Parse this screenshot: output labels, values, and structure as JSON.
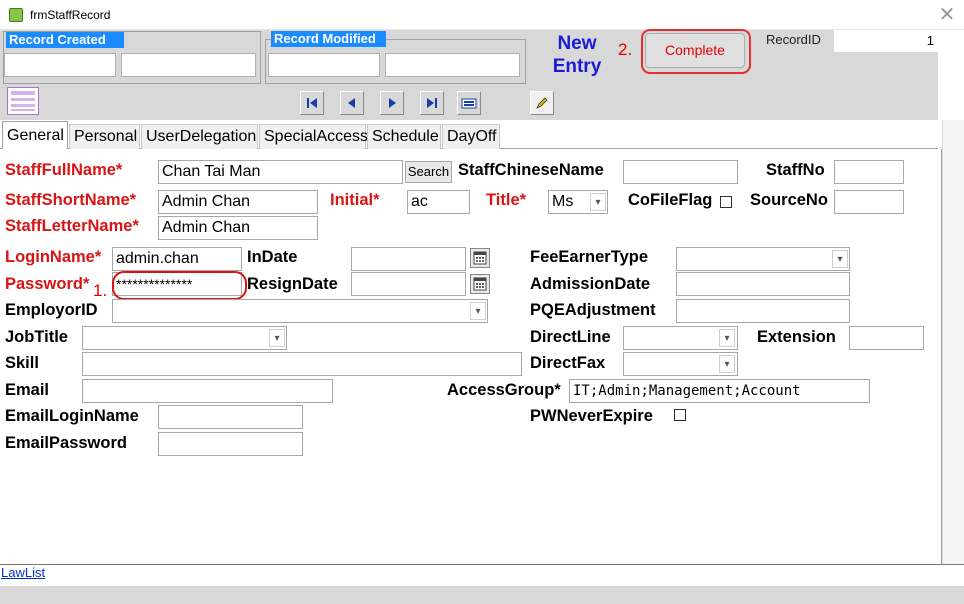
{
  "window": {
    "title": "frmStaffRecord",
    "close_glyph": "✕"
  },
  "header": {
    "record_created": {
      "title": "Record Created",
      "field1": "",
      "field2": ""
    },
    "record_modified": {
      "title": "Record Modified",
      "field1": "",
      "field2": ""
    },
    "new_entry": [
      "New",
      "Entry"
    ],
    "annotation2": "2.",
    "complete_label": "Complete",
    "recordid_label": "RecordID",
    "recordid_value": "1",
    "nav_icons": [
      "form-icon",
      "first-record-icon",
      "previous-record-icon",
      "next-record-icon",
      "last-record-icon",
      "new-record-icon",
      "edit-pencil-icon"
    ]
  },
  "tabs": [
    {
      "label": "General",
      "active": true
    },
    {
      "label": "Personal"
    },
    {
      "label": "UserDelegation"
    },
    {
      "label": "SpecialAccess"
    },
    {
      "label": "Schedule"
    },
    {
      "label": "DayOff"
    }
  ],
  "form": {
    "staff_full_name": {
      "label": "StaffFullName*",
      "value": "Chan Tai Man"
    },
    "search_label": "Search",
    "staff_chinese_name": {
      "label": "StaffChineseName",
      "value": ""
    },
    "staff_no": {
      "label": "StaffNo",
      "value": ""
    },
    "staff_short_name": {
      "label": "StaffShortName*",
      "value": "Admin Chan"
    },
    "initial": {
      "label": "Initial*",
      "value": "ac"
    },
    "title": {
      "label": "Title*",
      "value": "Ms"
    },
    "co_file_flag": {
      "label": "CoFileFlag",
      "checked": false
    },
    "source_no": {
      "label": "SourceNo",
      "value": ""
    },
    "staff_letter_name": {
      "label": "StaffLetterName*",
      "value": "Admin Chan"
    },
    "login_name": {
      "label": "LoginName*",
      "value": "admin.chan"
    },
    "in_date": {
      "label": "InDate",
      "value": ""
    },
    "fee_earner_type": {
      "label": "FeeEarnerType",
      "value": ""
    },
    "password": {
      "label": "Password*",
      "value": "**************"
    },
    "annotation1": "1.",
    "resign_date": {
      "label": "ResignDate",
      "value": ""
    },
    "admission_date": {
      "label": "AdmissionDate",
      "value": ""
    },
    "employor_id": {
      "label": "EmployorID",
      "value": ""
    },
    "pqe_adjustment": {
      "label": "PQEAdjustment",
      "value": ""
    },
    "job_title": {
      "label": "JobTitle",
      "value": ""
    },
    "direct_line": {
      "label": "DirectLine",
      "value": ""
    },
    "extension": {
      "label": "Extension",
      "value": ""
    },
    "skill": {
      "label": "Skill",
      "value": ""
    },
    "direct_fax": {
      "label": "DirectFax",
      "value": ""
    },
    "email": {
      "label": "Email",
      "value": ""
    },
    "access_group": {
      "label": "AccessGroup*",
      "value": "IT;Admin;Management;Account"
    },
    "email_login_name": {
      "label": "EmailLoginName",
      "value": ""
    },
    "pw_never_expire": {
      "label": "PWNeverExpire",
      "checked": false
    },
    "email_password": {
      "label": "EmailPassword",
      "value": ""
    }
  },
  "footer": {
    "lawlist_link": "LawList"
  },
  "colors": {
    "header_bg": "#d8d8d8",
    "group_title_bg": "#1a8cff",
    "required_label": "#d81414",
    "new_entry": "#1b1bd6",
    "annotation": "#e60000"
  }
}
